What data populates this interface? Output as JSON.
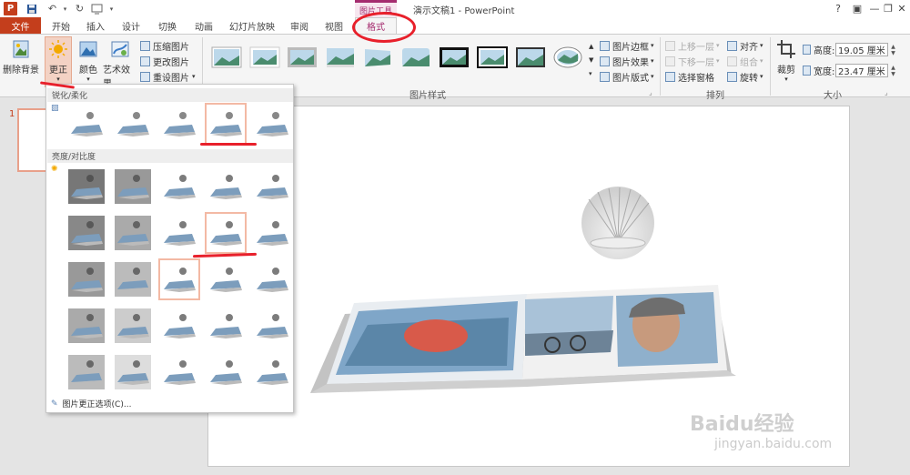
{
  "titlebar": {
    "app_logo": "P",
    "context_tab_title": "图片工具",
    "doc_title": "演示文稿1 - PowerPoint",
    "controls": [
      "?",
      "▣",
      "—",
      "❐",
      "✕"
    ]
  },
  "tabs": [
    "文件",
    "开始",
    "插入",
    "设计",
    "切换",
    "动画",
    "幻灯片放映",
    "审阅",
    "视图",
    "格式"
  ],
  "ribbon": {
    "remove_bg": "删除背景",
    "corrections": "更正",
    "color": "颜色",
    "art_effects": "艺术效果",
    "compress": "压缩图片",
    "change_pic": "更改图片",
    "reset_pic": "重设图片",
    "pic_border": "图片边框",
    "pic_effects": "图片效果",
    "pic_layout": "图片版式",
    "pic_styles_label": "图片样式",
    "bring_forward": "上移一层",
    "send_backward": "下移一层",
    "selection_pane": "选择窗格",
    "align": "对齐",
    "group": "组合",
    "rotate": "旋转",
    "arrange_label": "排列",
    "crop": "裁剪",
    "height_label": "高度:",
    "height_value": "19.05 厘米",
    "width_label": "宽度:",
    "width_value": "23.47 厘米",
    "size_label": "大小"
  },
  "slide_panel": {
    "slide_number": "1"
  },
  "dropdown": {
    "section_sharpen": "锐化/柔化",
    "section_brightness": "亮度/对比度",
    "footer": "图片更正选项(C)..."
  },
  "watermark": {
    "logo": "Baidu经验",
    "url": "jingyan.baidu.com"
  },
  "colors": {
    "ppt_brand": "#c43e1c",
    "context_accent": "#a52c6f",
    "annotation": "#e8202b",
    "selection": "#f3b9a4"
  }
}
